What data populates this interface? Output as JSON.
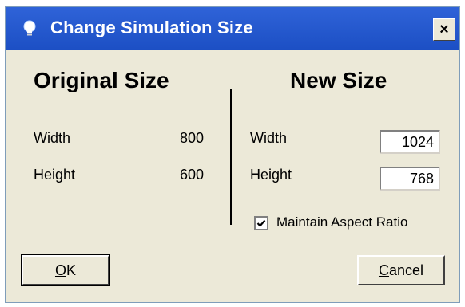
{
  "window": {
    "title": "Change Simulation Size",
    "close_label": "×"
  },
  "original": {
    "heading": "Original Size",
    "width_label": "Width",
    "width_value": "800",
    "height_label": "Height",
    "height_value": "600"
  },
  "new_size": {
    "heading": "New Size",
    "width_label": "Width",
    "width_value": "1024",
    "height_label": "Height",
    "height_value": "768",
    "aspect_label": "Maintain Aspect Ratio",
    "aspect_checked": true
  },
  "buttons": {
    "ok_mnemonic": "O",
    "ok_rest": "K",
    "cancel_mnemonic": "C",
    "cancel_rest": "ancel"
  },
  "icons": {
    "title_icon": "lightbulb-icon",
    "close_icon": "close-icon",
    "check_icon": "checkmark-icon"
  },
  "colors": {
    "titlebar": "#1c4fc4",
    "dialog_bg": "#ece9d8"
  }
}
